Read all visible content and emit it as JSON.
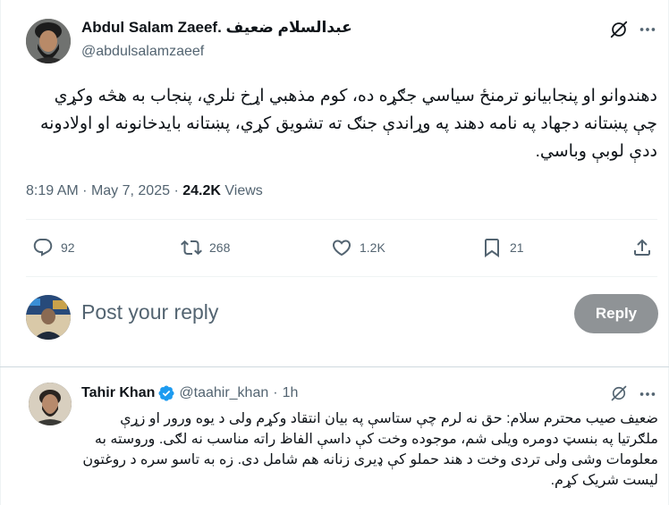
{
  "tweet": {
    "author_name": "Abdul Salam Zaeef. عبدالسلام ضعیف",
    "author_handle": "@abdulsalamzaeef",
    "text": "دهندوانو او پنجابیانو ترمنځ سیاسي جګړه ده، کوم مذهبي اړخ نلري، پنجاب به هڅه وکړي چې پښتانه دجهاد په نامه دهند په وړاندې جنګ ته تشویق کړي، پښتانه بایدخانونه او اولادونه ددې لوبې وباسي.",
    "time": "8:19 AM",
    "dot": "·",
    "date": "May 7, 2025",
    "views_count": "24.2K",
    "views_label": "Views",
    "stats": {
      "replies": "92",
      "reposts": "268",
      "likes": "1.2K",
      "bookmarks": "21"
    }
  },
  "reply_box": {
    "placeholder": "Post your reply",
    "button_label": "Reply"
  },
  "reply": {
    "author_name": "Tahir Khan",
    "author_handle": "@taahir_khan",
    "dot": "·",
    "time": "1h",
    "text": "ضعیف صیب محترم سلام: حق نه لرم چې ستاسې په بیان انتقاد وکړم ولی د یوه ورور او زړې ملګرتیا په بنسټ دومره ویلی شم، موجوده وخت کې داسې الفاظ راته مناسب نه لګی. وروسته به معلومات وشی ولی تردی وخت د هند حملو کې ډیری زنانه هم شامل دی. زه به تاسو سره د روغتون لیست شریک کړم."
  },
  "colors": {
    "text_primary": "#0f1419",
    "text_secondary": "#536471",
    "reply_button_bg": "#8f9396",
    "verified_blue": "#1d9bf0",
    "divider": "#eff3f4"
  },
  "icons": {
    "grok": "grok-icon",
    "more": "more-icon",
    "reply": "reply-icon",
    "repost": "repost-icon",
    "like": "heart-icon",
    "bookmark": "bookmark-icon",
    "share": "share-icon",
    "verified": "verified-badge-icon"
  }
}
